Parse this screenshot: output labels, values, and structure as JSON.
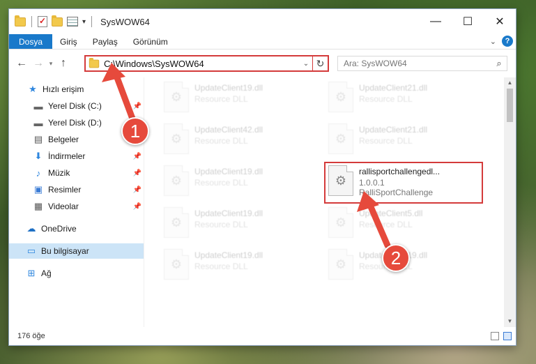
{
  "window": {
    "title": "SysWOW64",
    "controls": {
      "minimize": "—",
      "maximize": "☐",
      "close": "✕"
    }
  },
  "ribbon": {
    "tabs": [
      "Dosya",
      "Giriş",
      "Paylaş",
      "Görünüm"
    ],
    "help": "?"
  },
  "address": {
    "path": "C:\\Windows\\SysWOW64",
    "search_placeholder": "Ara: SysWOW64"
  },
  "sidebar": {
    "items": [
      {
        "label": "Hızlı erişim",
        "icon": "star-icon",
        "pinned": false
      },
      {
        "label": "Yerel Disk (C:)",
        "icon": "drive-icon",
        "pinned": true
      },
      {
        "label": "Yerel Disk (D:)",
        "icon": "drive-icon",
        "pinned": false
      },
      {
        "label": "Belgeler",
        "icon": "documents-icon",
        "pinned": true
      },
      {
        "label": "İndirmeler",
        "icon": "download-icon",
        "pinned": true
      },
      {
        "label": "Müzik",
        "icon": "music-icon",
        "pinned": true
      },
      {
        "label": "Resimler",
        "icon": "pictures-icon",
        "pinned": true
      },
      {
        "label": "Videolar",
        "icon": "video-icon",
        "pinned": true
      },
      {
        "label": "OneDrive",
        "icon": "cloud-icon",
        "pinned": false
      },
      {
        "label": "Bu bilgisayar",
        "icon": "computer-icon",
        "pinned": false,
        "selected": true
      },
      {
        "label": "Ağ",
        "icon": "network-icon",
        "pinned": false
      }
    ]
  },
  "files": [
    {
      "name": "UpdateClient19.dll",
      "sub": "Resource DLL",
      "faded": true
    },
    {
      "name": "UpdateClient21.dll",
      "sub": "Resource DLL",
      "faded": true
    },
    {
      "name": "UpdateClient42.dll",
      "sub": "Resource DLL",
      "faded": true
    },
    {
      "name": "UpdateClient21.dll",
      "sub": "Resource DLL",
      "faded": true
    },
    {
      "name": "UpdateClient19.dll",
      "sub": "Resource DLL",
      "faded": true
    },
    {
      "name": "rallisportchallengedl...",
      "version": "1.0.0.1",
      "sub": "RalliSportChallenge",
      "faded": false
    },
    {
      "name": "UpdateClient19.dll",
      "sub": "Resource DLL",
      "faded": true
    },
    {
      "name": "UpdateClient5.dll",
      "sub": "Resource DLL",
      "faded": true
    },
    {
      "name": "UpdateClient19.dll",
      "sub": "Resource DLL",
      "faded": true
    },
    {
      "name": "UpdateClient19.dll",
      "sub": "Resource DLL",
      "faded": true
    }
  ],
  "status": {
    "count": "176 öğe"
  },
  "annotations": {
    "badge1": "1",
    "badge2": "2",
    "color": "#e64a3c"
  }
}
